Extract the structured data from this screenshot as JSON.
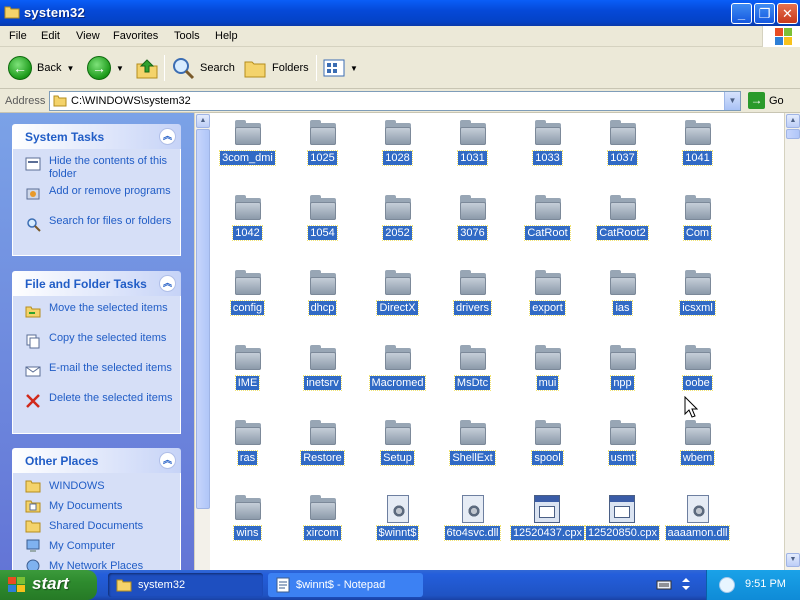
{
  "window": {
    "title": "system32",
    "min": "_",
    "max": "❐",
    "close": "✕"
  },
  "menu": [
    "File",
    "Edit",
    "View",
    "Favorites",
    "Tools",
    "Help"
  ],
  "toolbar": {
    "back": "Back",
    "search": "Search",
    "folders": "Folders"
  },
  "address": {
    "label": "Address",
    "path": "C:\\WINDOWS\\system32",
    "go": "Go"
  },
  "system_tasks": {
    "title": "System Tasks",
    "items": [
      "Hide the contents of this folder",
      "Add or remove programs",
      "Search for files or folders"
    ]
  },
  "file_tasks": {
    "title": "File and Folder Tasks",
    "items": [
      "Move the selected items",
      "Copy the selected items",
      "E-mail the selected items",
      "Delete the selected items"
    ]
  },
  "other_places": {
    "title": "Other Places",
    "items": [
      "WINDOWS",
      "My Documents",
      "Shared Documents",
      "My Computer",
      "My Network Places"
    ]
  },
  "files": {
    "row1": [
      "3com_dmi",
      "1025",
      "1028",
      "1031",
      "1033",
      "1037",
      "1041"
    ],
    "row2": [
      "1042",
      "1054",
      "2052",
      "3076",
      "CatRoot",
      "CatRoot2",
      "Com"
    ],
    "row3": [
      "config",
      "dhcp",
      "DirectX",
      "drivers",
      "export",
      "ias",
      "icsxml"
    ],
    "row4": [
      "IME",
      "inetsrv",
      "Macromed",
      "MsDtc",
      "mui",
      "npp",
      "oobe"
    ],
    "row5": [
      "ras",
      "Restore",
      "Setup",
      "ShellExt",
      "spool",
      "usmt",
      "wbem"
    ],
    "row6": [
      "wins",
      "xircom",
      "$winnt$",
      "6to4svc.dll",
      "12520437.cpx",
      "12520850.cpx",
      "aaaamon.dll"
    ]
  },
  "taskbar": {
    "start": "start",
    "tasks": [
      "system32",
      "$winnt$ - Notepad"
    ],
    "clock": "9:51 PM"
  },
  "colors": {
    "titlebar": "#0549d8",
    "selection": "#316ac5",
    "taskpane_link": "#215dc6",
    "start_green": "#2e8b2e"
  }
}
